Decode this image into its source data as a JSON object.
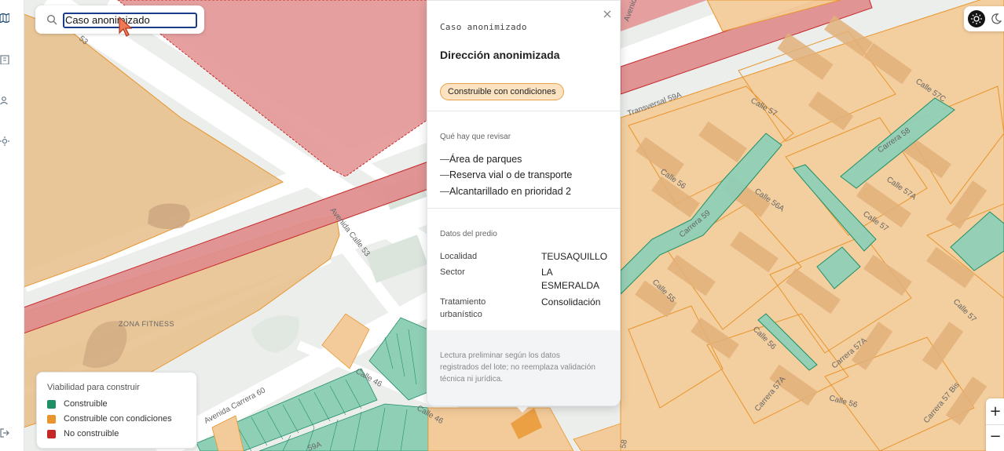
{
  "search": {
    "value": "Caso anonimizado"
  },
  "panel": {
    "kicker": "Caso anonimizado",
    "title": "Dirección anonimizada",
    "status": "Construible con condiciones",
    "review_title": "Qué hay que revisar",
    "review_items": [
      "Área de parques",
      "Reserva vial o de transporte",
      "Alcantarillado en prioridad 2"
    ],
    "property_title": "Datos del predio",
    "properties": [
      {
        "label": "Localidad",
        "value": "TEUSAQUILLO"
      },
      {
        "label": "Sector",
        "value": "LA ESMERALDA"
      },
      {
        "label": "Tratamiento urbanístico",
        "value": "Consolidación"
      }
    ],
    "footer_note": "Lectura preliminar según los datos registrados del lote; no reemplaza validación técnica ni jurídica."
  },
  "legend": {
    "title": "Viabilidad para construir",
    "items": [
      {
        "label": "Construible",
        "color": "#1f8f66"
      },
      {
        "label": "Construible con condiciones",
        "color": "#e8952e"
      },
      {
        "label": "No construible",
        "color": "#c62828"
      }
    ]
  },
  "zoom": {
    "in_label": "+",
    "out_label": "−"
  },
  "map": {
    "street_labels": [
      "Avenida Calle 53",
      "Avenida Carrera 60",
      "Calle 46",
      "Calle 46",
      "Transversal 59A",
      "Calle 57",
      "Carrera 58",
      "Calle 57C",
      "Calle 56",
      "Calle 56A",
      "Carrera 59",
      "Calle 57A",
      "Calle 57",
      "Calle 55",
      "Calle 56",
      "Carrera 57A",
      "Calle 57",
      "Calle 56",
      "Carrera 57A",
      "Carrera 57 Bis",
      "Avenida",
      "ZONA FITNESS",
      "53",
      "59A",
      "58"
    ]
  },
  "colors": {
    "conditional_fill": "#f3cb9a",
    "buildable_fill": "#8fcfb6",
    "not_buildable_fill": "#e59a99",
    "accent": "#e8952e"
  }
}
